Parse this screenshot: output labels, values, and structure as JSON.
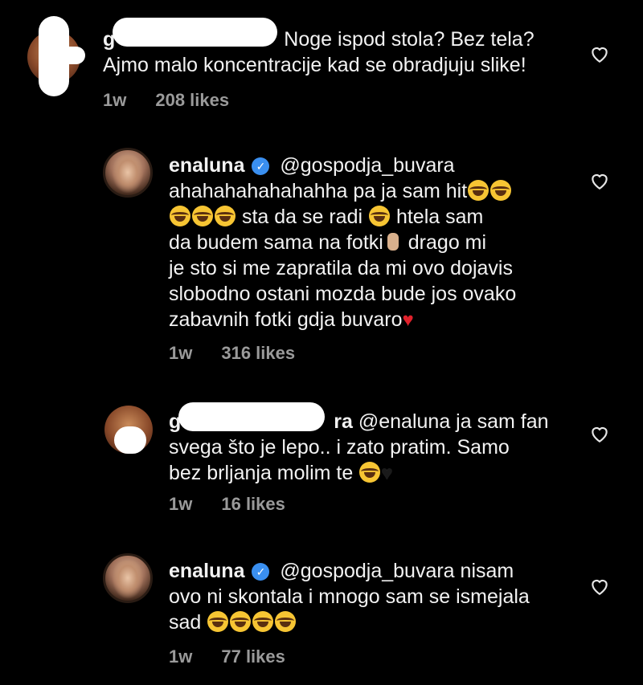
{
  "comments": [
    {
      "username": "g",
      "text_l1": "Noge ispod stola? Bez tela?",
      "text_l2": "Ajmo malo koncentracije kad se obradjuju slike!",
      "time": "1w",
      "likes": "208 likes"
    },
    {
      "username": "enaluna",
      "mention": "@gospodja_buvara",
      "l1b": "ahahahahahahahha pa ja sam hit",
      "l2b": "sta da se radi",
      "l2c": "htela sam",
      "l3a": "da budem sama na fotki",
      "l3b": "drago mi",
      "l4": "je sto si me zapratila da mi ovo dojavis",
      "l5": "slobodno ostani mozda bude jos ovako",
      "l6": "zabavnih fotki gdja buvaro",
      "time": "1w",
      "likes": "316 likes"
    },
    {
      "username_tail": "ra",
      "username_head": "g",
      "l1": "@enaluna ja sam fan",
      "l2": "svega što je lepo.. i zato pratim. Samo",
      "l3": "bez brljanja molim te",
      "time": "1w",
      "likes": "16 likes"
    },
    {
      "username": "enaluna",
      "mention": "@gospodja_buvara",
      "l1b": "nisam",
      "l2": "ovo ni skontala i mnogo sam se ismejala",
      "l3": "sad",
      "time": "1w",
      "likes": "77 likes"
    }
  ],
  "icons": {
    "heart": "heart-outline-icon",
    "verified": "verified-badge-icon",
    "laugh": "face-with-tears-of-joy-emoji",
    "peace": "victory-hand-emoji"
  },
  "colors": {
    "background": "#000000",
    "text": "#f2f2f2",
    "meta": "#9a9a9a",
    "verified": "#3a8ff0"
  }
}
